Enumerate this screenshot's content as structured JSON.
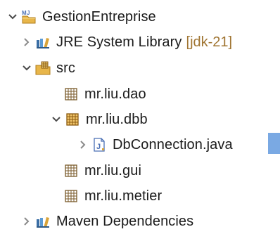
{
  "project_explorer": {
    "project": {
      "label": "GestionEntreprise",
      "icon": "maven-java-project-icon",
      "expanded": true
    },
    "jre": {
      "label": "JRE System Library",
      "decoration": "[jdk-21]",
      "icon": "library-icon",
      "expanded": false
    },
    "src": {
      "label": "src",
      "icon": "source-folder-icon",
      "expanded": true
    },
    "packages": [
      {
        "label": "mr.liu.dao",
        "icon": "package-icon"
      },
      {
        "label": "mr.liu.dbb",
        "icon": "package-open-icon",
        "expanded": true
      },
      {
        "label": "mr.liu.gui",
        "icon": "package-icon"
      },
      {
        "label": "mr.liu.metier",
        "icon": "package-icon"
      }
    ],
    "java_file": {
      "label": "DbConnection.java",
      "icon": "java-file-icon",
      "expanded": false
    },
    "maven": {
      "label": "Maven Dependencies",
      "icon": "library-icon",
      "expanded": false
    },
    "colors": {
      "text": "#1b1b1b",
      "decoration": "#a07532",
      "selection": "#7aa9e3",
      "twisty": "#6f6f6f"
    }
  }
}
